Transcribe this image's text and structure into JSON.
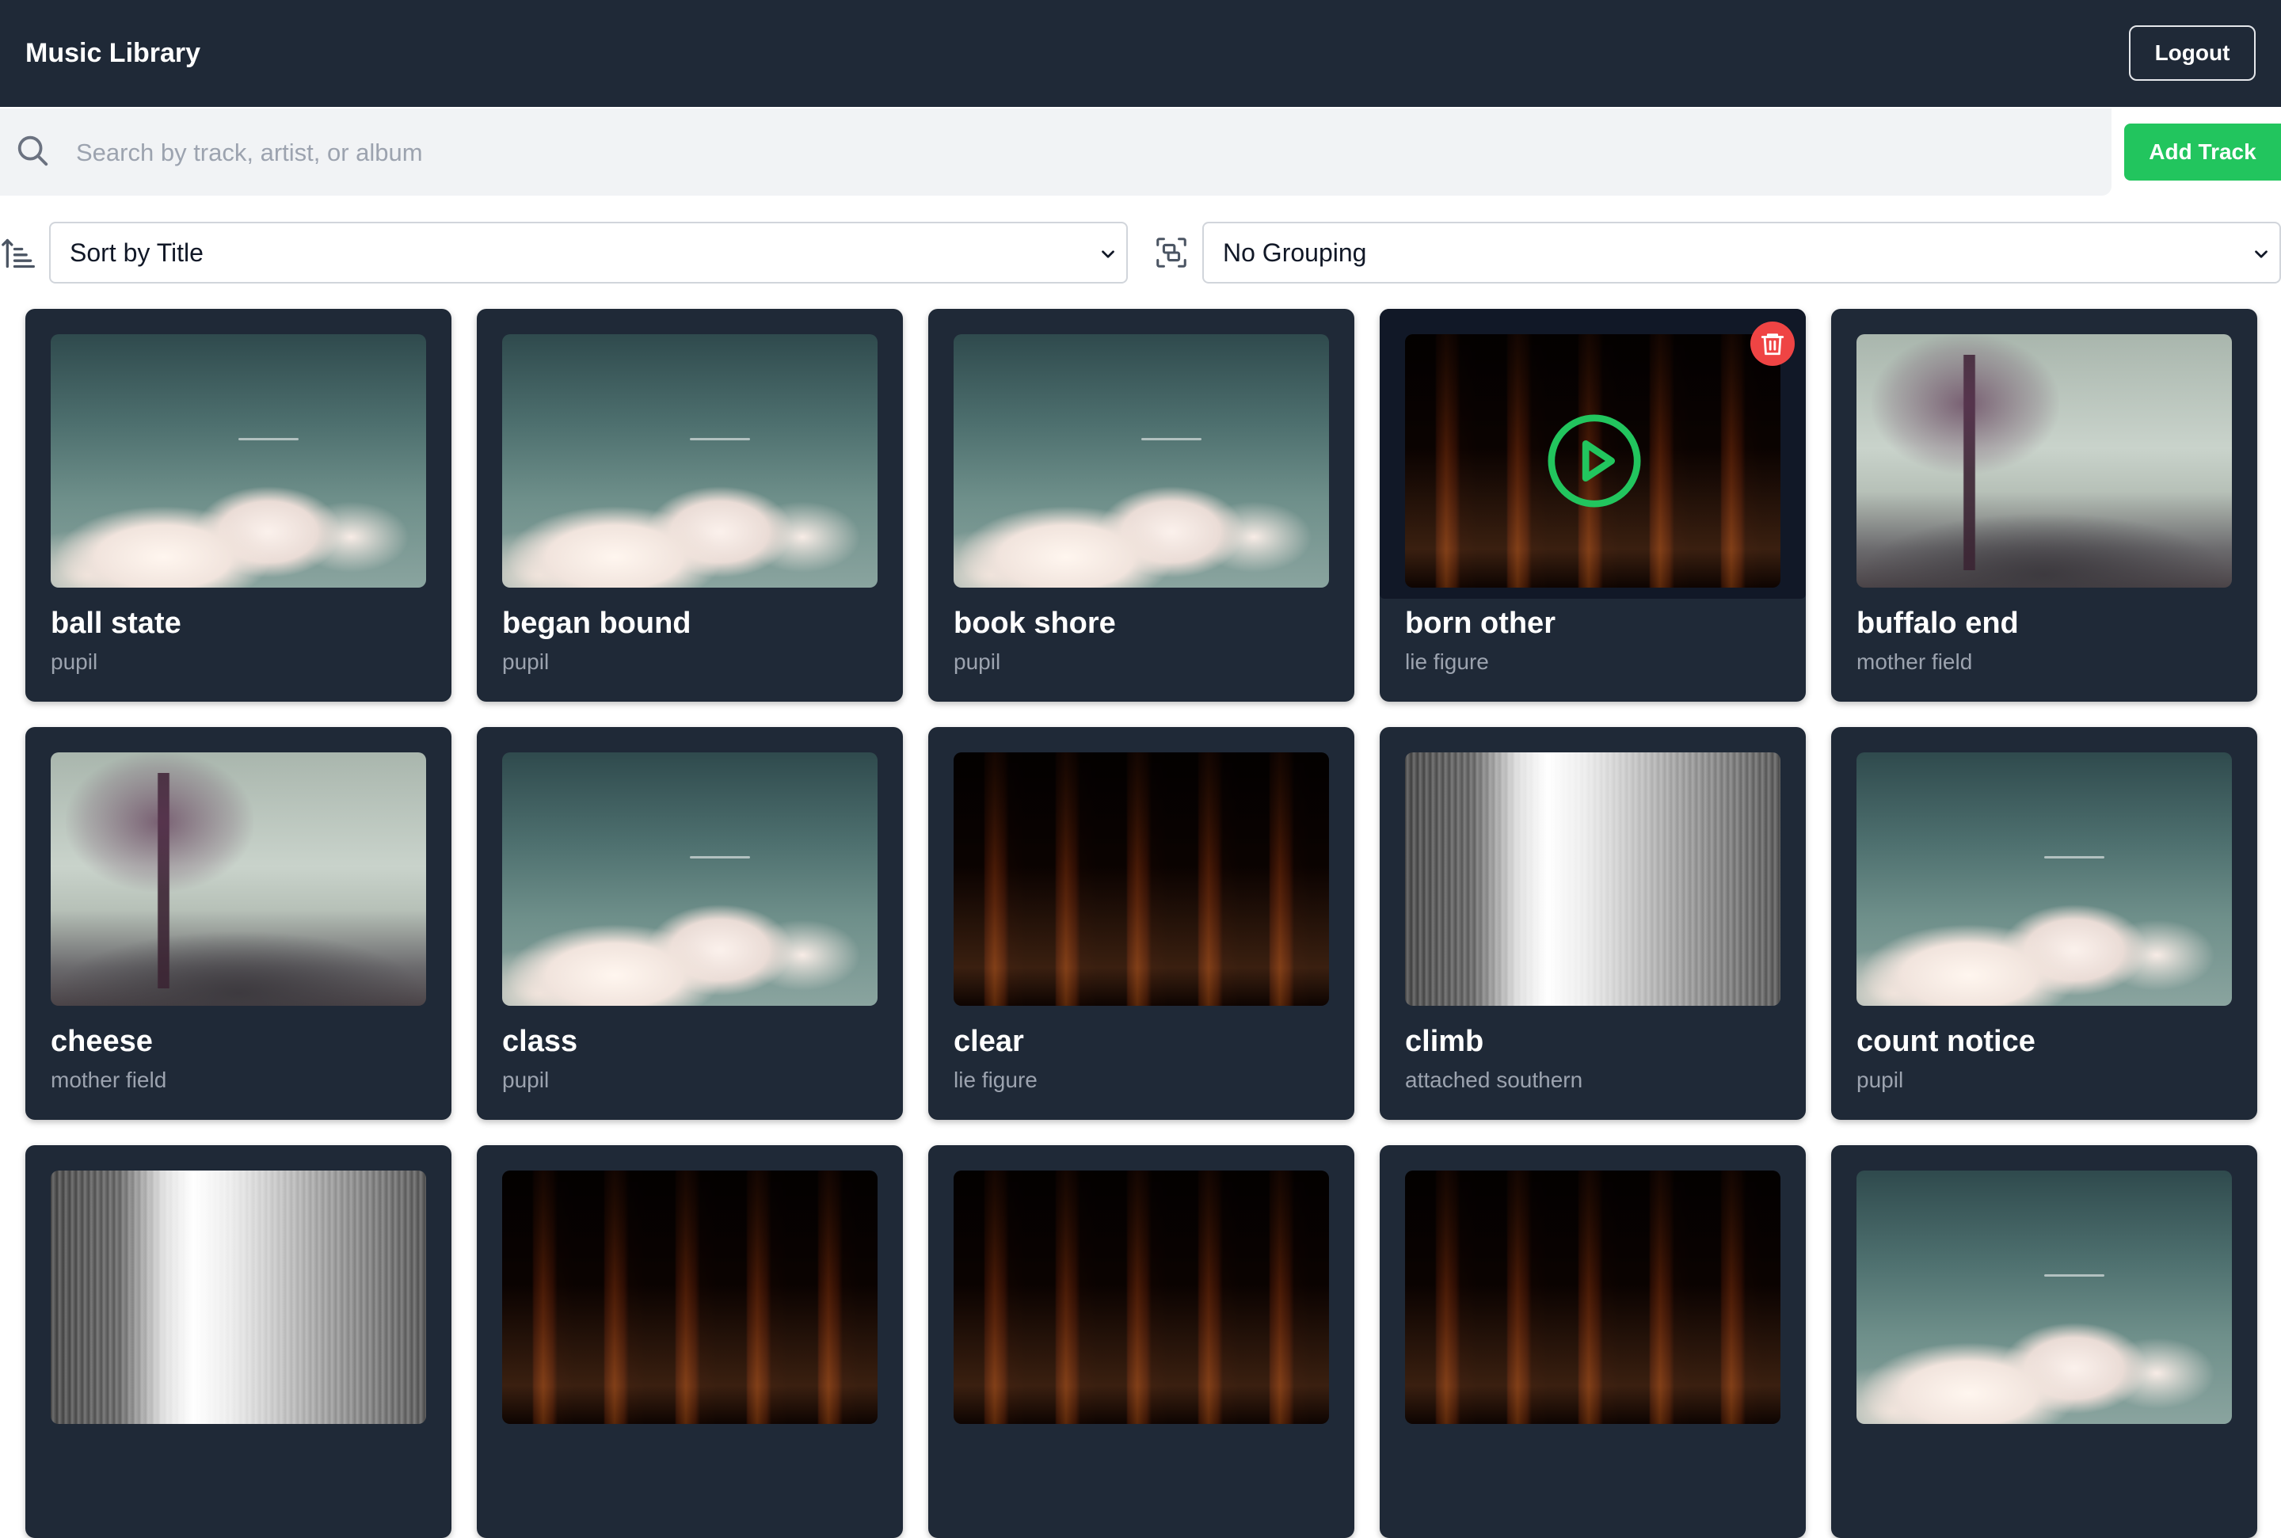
{
  "header": {
    "title": "Music Library",
    "logout_label": "Logout"
  },
  "search": {
    "placeholder": "Search by track, artist, or album",
    "value": ""
  },
  "add_track_label": "Add Track",
  "sort": {
    "selected": "Sort by Title"
  },
  "grouping": {
    "selected": "No Grouping"
  },
  "tracks": [
    {
      "title": "ball state",
      "artist": "pupil",
      "art": "clouds"
    },
    {
      "title": "began bound",
      "artist": "pupil",
      "art": "clouds"
    },
    {
      "title": "book shore",
      "artist": "pupil",
      "art": "clouds"
    },
    {
      "title": "born other",
      "artist": "lie figure",
      "art": "cloister",
      "hovered": true
    },
    {
      "title": "buffalo end",
      "artist": "mother field",
      "art": "misty-trees"
    },
    {
      "title": "cheese",
      "artist": "mother field",
      "art": "misty-trees"
    },
    {
      "title": "class",
      "artist": "pupil",
      "art": "clouds"
    },
    {
      "title": "clear",
      "artist": "lie figure",
      "art": "cloister"
    },
    {
      "title": "climb",
      "artist": "attached southern",
      "art": "waterfall"
    },
    {
      "title": "count notice",
      "artist": "pupil",
      "art": "clouds"
    },
    {
      "title": "",
      "artist": "",
      "art": "waterfall"
    },
    {
      "title": "",
      "artist": "",
      "art": "cloister"
    },
    {
      "title": "",
      "artist": "",
      "art": "cloister"
    },
    {
      "title": "",
      "artist": "",
      "art": "cloister"
    },
    {
      "title": "",
      "artist": "",
      "art": "clouds"
    }
  ],
  "icons": {
    "search": "search-icon",
    "sort": "sort-ascending-icon",
    "group": "group-icon",
    "chevron": "chevron-down-icon",
    "play": "play-icon",
    "delete": "trash-icon"
  },
  "colors": {
    "header_bg": "#1f2937",
    "card_bg": "#1f2937",
    "accent_green": "#22c55e",
    "delete_red": "#ef4444",
    "muted_text": "#9ca3af"
  }
}
